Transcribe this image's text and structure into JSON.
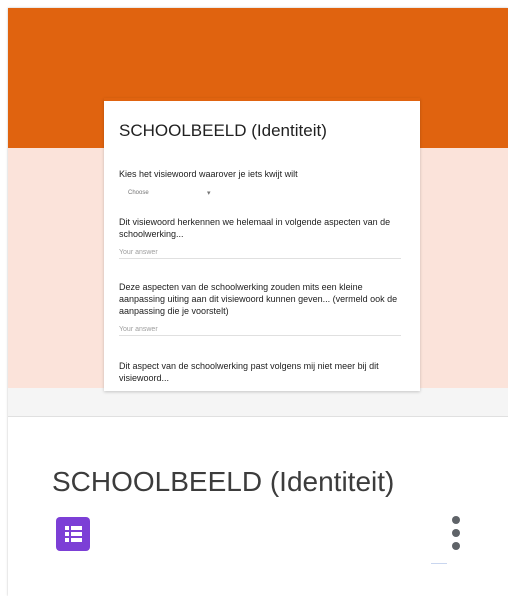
{
  "thumbnail": {
    "form_title": "SCHOOLBEELD (Identiteit)",
    "questions": [
      "Kies het visiewoord waarover je iets kwijt wilt",
      "Dit visiewoord herkennen we helemaal in volgende aspecten van de schoolwerking...",
      "Deze aspecten van de schoolwerking zouden mits een kleine aanpassing uiting aan dit visiewoord kunnen geven... (vermeld ook de aanpassing die je voorstelt)",
      "Dit aspect van de schoolwerking past volgens mij niet meer bij dit visiewoord..."
    ],
    "dropdown_placeholder": "Choose",
    "answer_placeholder": "Your answer",
    "colors": {
      "header": "#e0630f",
      "background": "#fbe3da"
    }
  },
  "card": {
    "title": "SCHOOLBEELD (Identiteit)",
    "icon": "google-forms-icon",
    "menu_icon": "more-vert-icon",
    "accent": "#7c3fd6"
  }
}
